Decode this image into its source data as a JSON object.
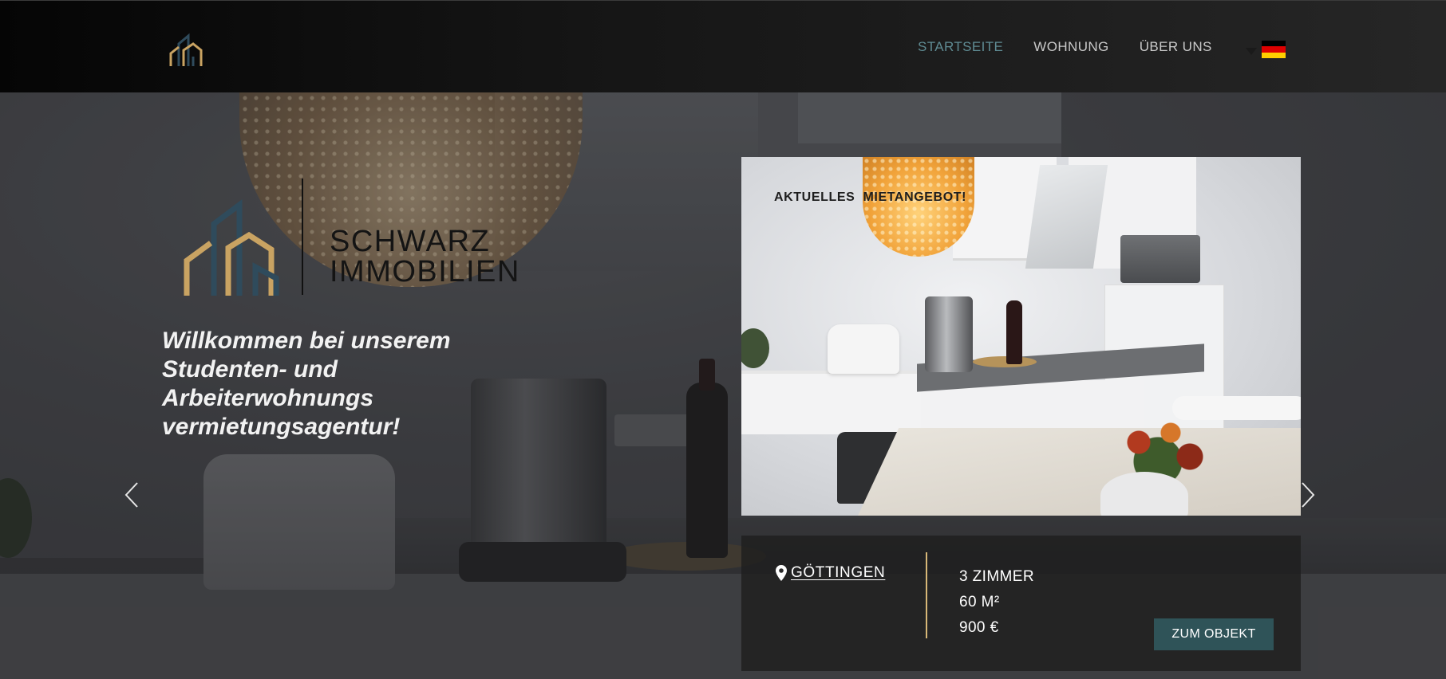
{
  "nav": {
    "logo_icon": "schwarz-immobilien-logo-icon",
    "items": [
      {
        "label": "STARTSEITE",
        "active": true
      },
      {
        "label": "WOHNUNG",
        "active": false
      },
      {
        "label": "ÜBER UNS",
        "active": false
      }
    ],
    "language": {
      "icon": "german-flag-icon",
      "caret_icon": "caret-down-icon"
    }
  },
  "brand": {
    "name_line1": "SCHWARZ",
    "name_line2": "IMMOBILIEN",
    "mark_icon": "schwarz-immobilien-logo-icon"
  },
  "hero": {
    "welcome": "Willkommen bei unserem Studenten- und Arbeiterwohnungs vermietungsagentur!",
    "prev_icon": "chevron-left-icon",
    "next_icon": "chevron-right-icon"
  },
  "offer": {
    "label": "AKTUELLES  MIETANGEBOT!",
    "location": "GÖTTINGEN",
    "location_icon": "map-pin-icon",
    "rooms": "3 ZIMMER",
    "area": "60 M²",
    "price": "900 €",
    "cta": "ZUM OBJEKT"
  },
  "colors": {
    "accent_teal": "#5f8b93",
    "button": "#2f5358",
    "gold": "#d8b878",
    "logo_blue": "#2f4b5c"
  }
}
